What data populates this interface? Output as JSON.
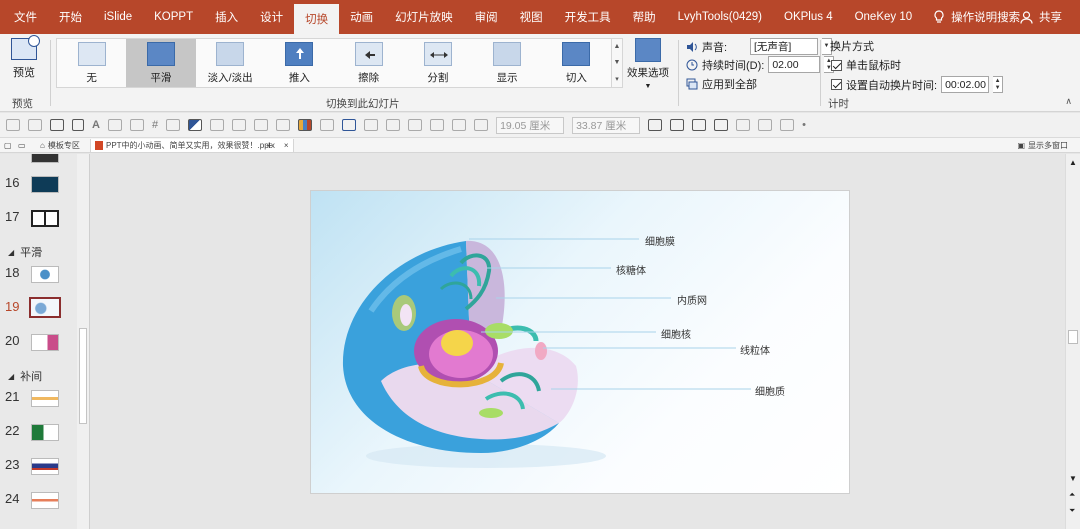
{
  "menu": {
    "tabs": [
      "文件",
      "开始",
      "iSlide",
      "KOPPT",
      "插入",
      "设计",
      "切换",
      "动画",
      "幻灯片放映",
      "审阅",
      "视图",
      "开发工具",
      "帮助",
      "LvyhTools(0429)",
      "OKPlus 4",
      "OneKey 10"
    ],
    "active_tab": "切换",
    "search_label": "操作说明搜索",
    "share_label": "共享"
  },
  "ribbon": {
    "preview": {
      "label": "预览",
      "group_label": "预览"
    },
    "transitions": {
      "items": [
        "无",
        "平滑",
        "淡入/淡出",
        "推入",
        "擦除",
        "分割",
        "显示",
        "切入"
      ],
      "selected": "平滑",
      "group_label": "切换到此幻灯片",
      "effect_options_label": "效果选项"
    },
    "timing": {
      "sound_label": "声音:",
      "sound_value": "[无声音]",
      "duration_label": "持续时间(D):",
      "duration_value": "02.00",
      "apply_all_label": "应用到全部",
      "advance_label": "换片方式",
      "on_click_label": "单击鼠标时",
      "after_label": "设置自动换片时间:",
      "after_value": "00:02.00",
      "group_label": "计时"
    }
  },
  "toolbar2": {
    "width_value": "19.05 厘米",
    "height_value": "33.87 厘米"
  },
  "doc_tabs": {
    "tab1": "模板专区",
    "tab2": "PPT中的小动画、简单又实用，效果很赞！.pptx",
    "right_label": "显示多窗口"
  },
  "slides_panel": {
    "sections": [
      "平滑",
      "补间"
    ],
    "slides": [
      "16",
      "17",
      "18",
      "19",
      "20",
      "21",
      "22",
      "23",
      "24"
    ],
    "current": "19"
  },
  "slide": {
    "labels": [
      "细胞膜",
      "核糖体",
      "内质网",
      "细胞核",
      "线粒体",
      "细胞质"
    ]
  },
  "colors": {
    "accent": "#b7472a",
    "ribbon_bg": "#f3f3f3"
  }
}
